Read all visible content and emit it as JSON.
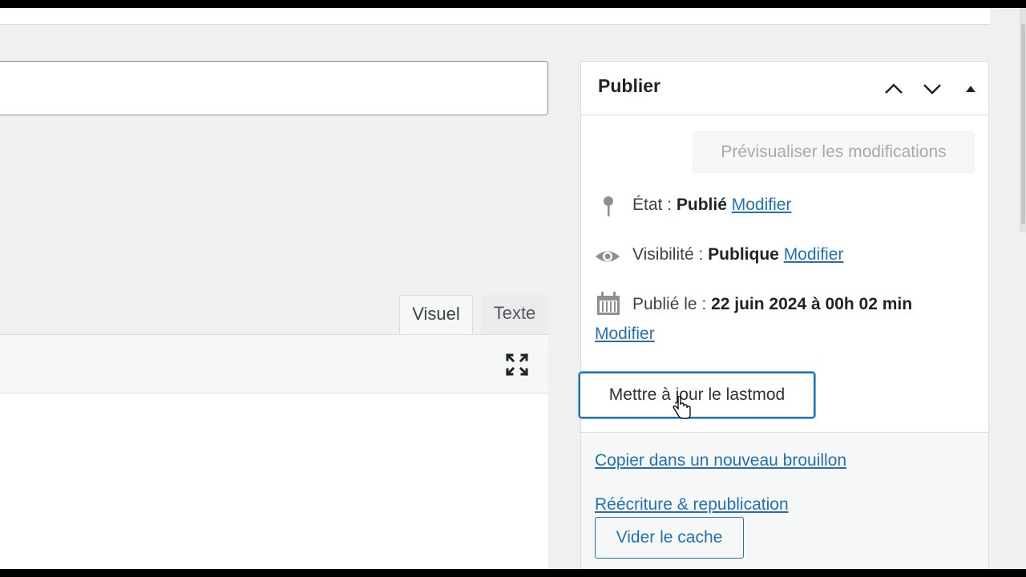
{
  "editor": {
    "tabs": [
      {
        "label": "Visuel",
        "active": true
      },
      {
        "label": "Texte",
        "active": false
      }
    ]
  },
  "publish": {
    "title": "Publier",
    "preview_label": "Prévisualiser les modifications",
    "status": {
      "label": "État :",
      "value": "Publié",
      "edit": "Modifier"
    },
    "visibility": {
      "label": "Visibilité :",
      "value": "Publique",
      "edit": "Modifier"
    },
    "published": {
      "label": "Publié le :",
      "value": "22 juin 2024 à 00h 02 min",
      "edit": "Modifier"
    },
    "lastmod_label": "Mettre à jour le lastmod",
    "copy_draft": "Copier dans un nouveau brouillon",
    "rewrite": "Réécriture & republication",
    "clear_cache": "Vider le cache"
  },
  "icons": {
    "status": "pin-icon",
    "visibility": "eye-icon",
    "date": "calendar-icon",
    "fullscreen": "fullscreen-icon",
    "move_up": "chevron-up-icon",
    "move_down": "chevron-down-icon",
    "toggle": "triangle-up-icon"
  },
  "colors": {
    "link": "#2271b1",
    "border": "#dcdcde",
    "background": "#f0f0f1"
  }
}
